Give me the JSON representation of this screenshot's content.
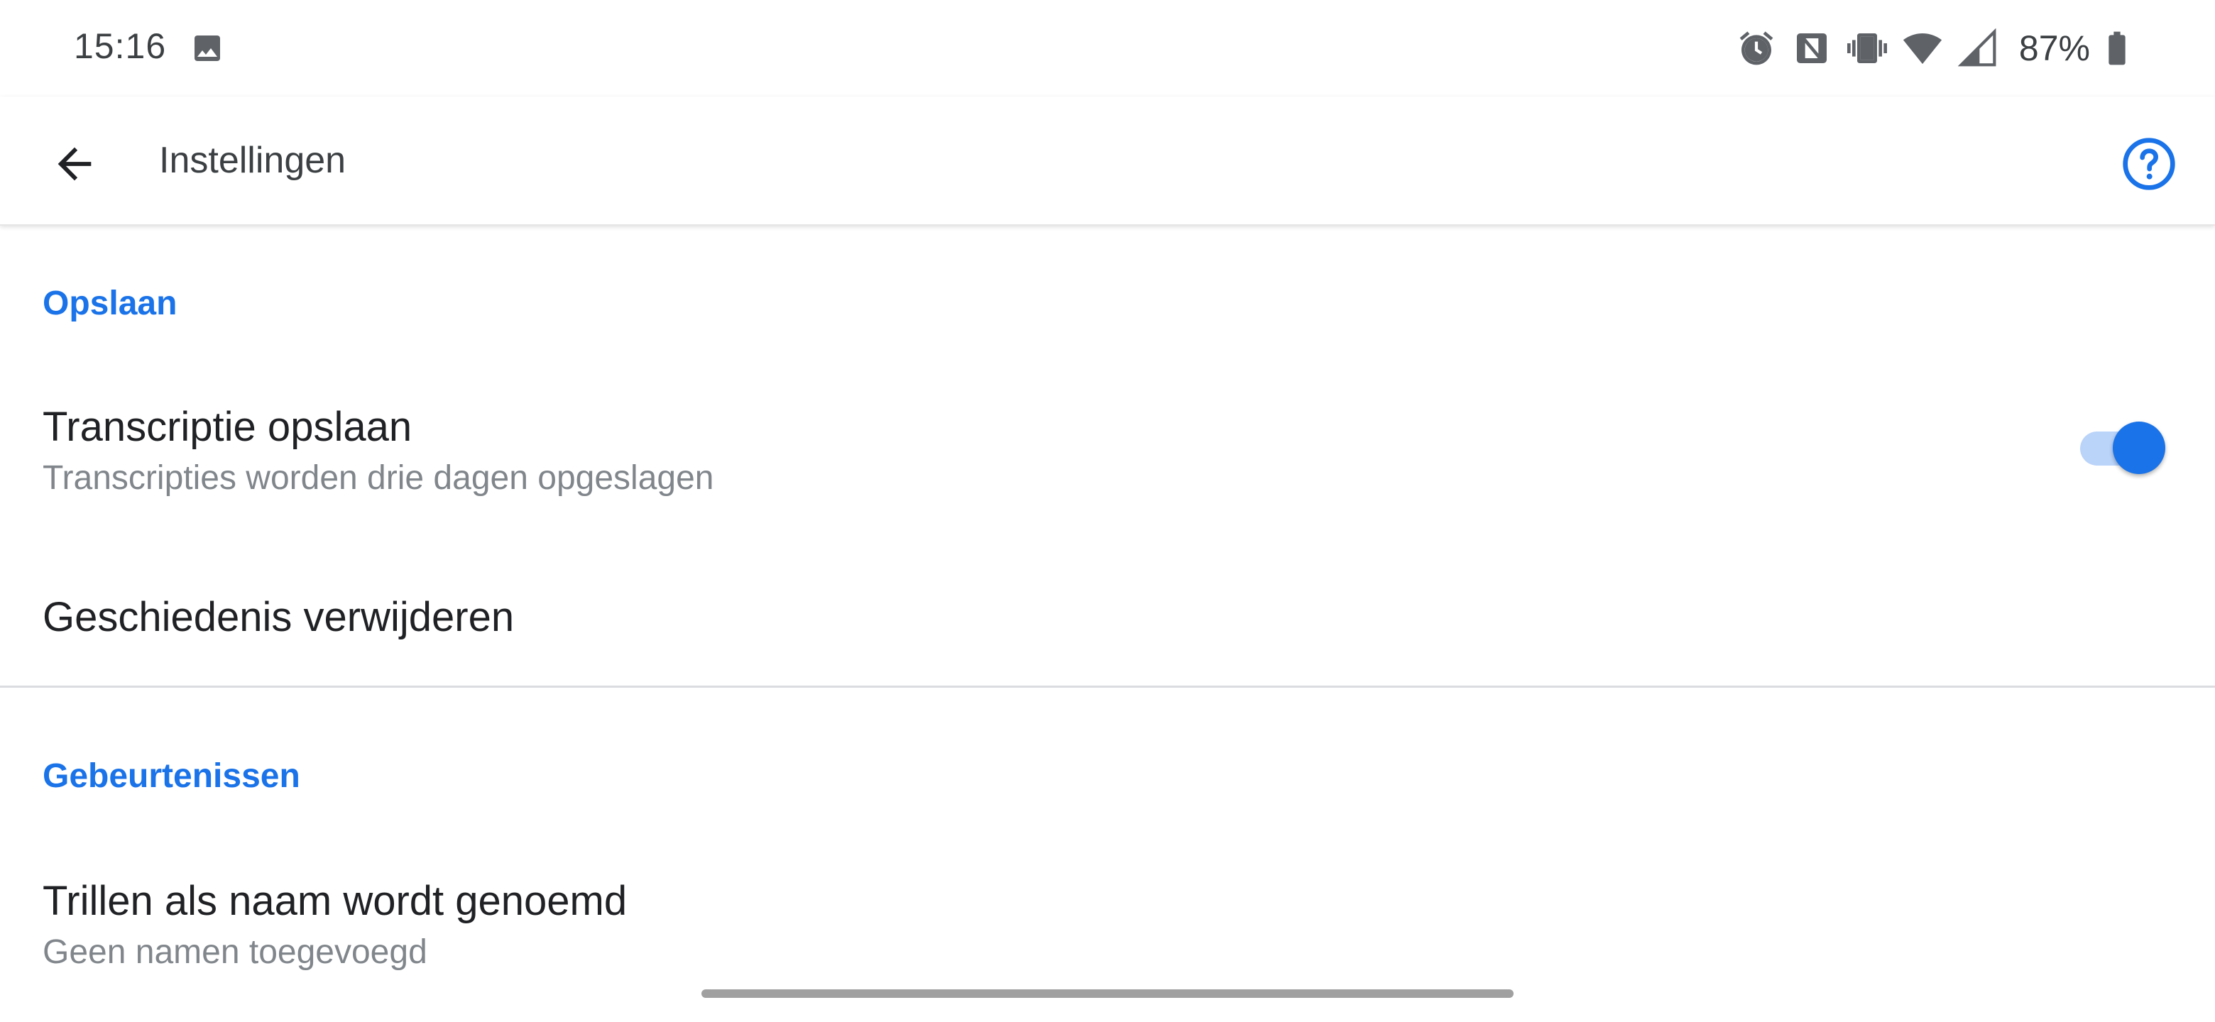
{
  "status_bar": {
    "time": "15:16",
    "battery_percent": "87%",
    "icons": [
      "gallery-icon",
      "alarm-icon",
      "nfc-icon",
      "vibrate-icon",
      "wifi-icon",
      "signal-icon",
      "battery-icon"
    ]
  },
  "app_bar": {
    "title": "Instellingen",
    "back_icon": "back-arrow-icon",
    "help_icon": "help-icon"
  },
  "sections": [
    {
      "header": "Opslaan",
      "items": [
        {
          "title": "Transcriptie opslaan",
          "subtitle": "Transcripties worden drie dagen opgeslagen",
          "toggle_on": true
        },
        {
          "title": "Geschiedenis verwijderen"
        }
      ]
    },
    {
      "header": "Gebeurtenissen",
      "items": [
        {
          "title": "Trillen als naam wordt genoemd",
          "subtitle": "Geen namen toegevoegd"
        }
      ]
    }
  ],
  "colors": {
    "accent": "#1a73e8",
    "toggle_track": "#b9d3f9",
    "title_text": "#202124",
    "subtitle_text": "#80868b"
  }
}
